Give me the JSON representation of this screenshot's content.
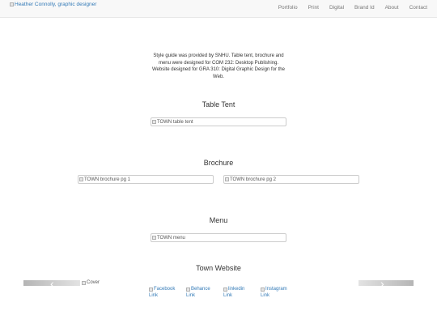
{
  "navbar": {
    "brand_alt": "Heather Connolly, graphic designer",
    "links": [
      "Portfolio",
      "Print",
      "Digital",
      "Brand Id",
      "About",
      "Contact"
    ]
  },
  "intro": "Style guide was provided by SNHU. Table tent, brochure and menu were designed for COM 232: Desktop Publishing. Website designed for GRA 310: Digital Graphic Design for the Web.",
  "sections": {
    "table_tent": {
      "title": "Table Tent",
      "image_alt": "TOWN table tent"
    },
    "brochure": {
      "title": "Brochure",
      "image1_alt": "TOWN brochure pg 1",
      "image2_alt": "TOWN brochure pg 2"
    },
    "menu": {
      "title": "Menu",
      "image_alt": "TOWN menu"
    },
    "website": {
      "title": "Town Website",
      "cover_alt": "Cover",
      "social": [
        {
          "first": "Facebook",
          "second": "Link"
        },
        {
          "first": "Behance",
          "second": "Link"
        },
        {
          "first": "linkedin",
          "second": "Link"
        },
        {
          "first": "Instagram",
          "second": "Link"
        }
      ]
    }
  },
  "icons": {
    "broken_image": "broken-image-icon",
    "prev": "chevron-left-icon",
    "next": "chevron-right-icon"
  },
  "colors": {
    "link": "#337ab7",
    "navbar_bg": "#f8f8f8"
  }
}
